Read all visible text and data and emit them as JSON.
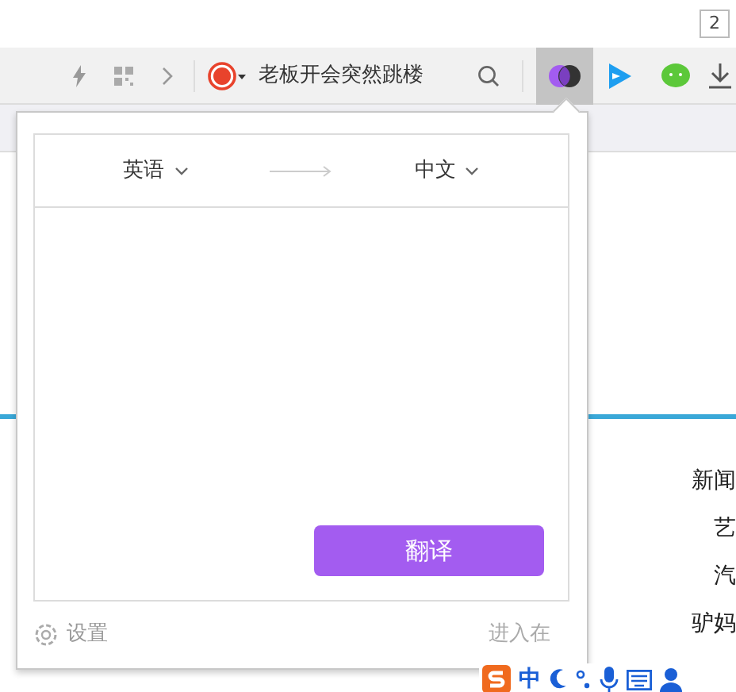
{
  "tab_counter": "2",
  "toolbar": {
    "search_text": "老板开会突然跳楼",
    "translate_active": true
  },
  "page_links": [
    "新闻",
    "艺",
    "汽",
    "驴妈"
  ],
  "translate_popup": {
    "source_language": "英语",
    "target_language": "中文",
    "translate_button": "翻译",
    "settings": "设置",
    "online_link": "进入在"
  },
  "ime_bar": {
    "mode": "中"
  }
}
